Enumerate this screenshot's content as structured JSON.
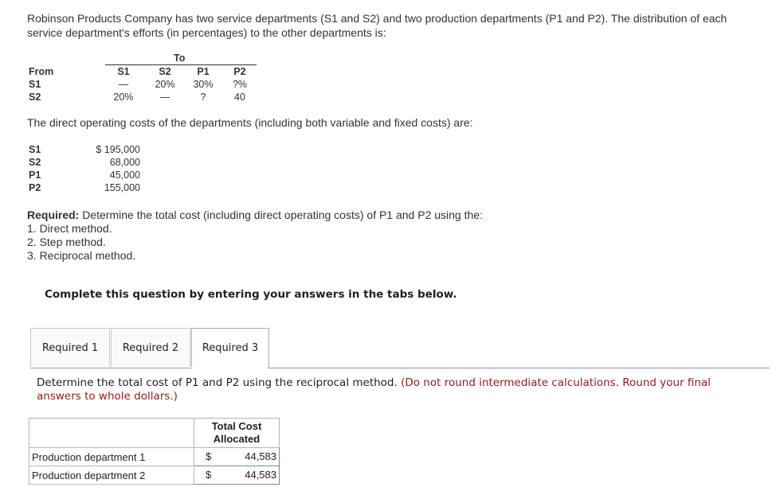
{
  "intro": "Robinson Products Company has two service departments (S1 and S2) and two production departments (P1 and P2). The distribution of each service department's efforts (in percentages) to the other departments is:",
  "distribution": {
    "to_label": "To",
    "from_label": "From",
    "columns": [
      "S1",
      "S2",
      "P1",
      "P2"
    ],
    "rows": [
      {
        "from": "S1",
        "values": [
          "—",
          "20%",
          "30%",
          "?%"
        ]
      },
      {
        "from": "S2",
        "values": [
          "20%",
          "—",
          "?",
          "40"
        ]
      }
    ]
  },
  "direct_costs_title": "The direct operating costs of the departments (including both variable and fixed costs) are:",
  "direct_costs": [
    {
      "dept": "S1",
      "value": "$ 195,000"
    },
    {
      "dept": "S2",
      "value": "68,000"
    },
    {
      "dept": "P1",
      "value": "45,000"
    },
    {
      "dept": "P2",
      "value": "155,000"
    }
  ],
  "required": {
    "label": "Required:",
    "text": " Determine the total cost (including direct operating costs) of P1 and P2 using the:",
    "items": [
      "1. Direct method.",
      "2. Step method.",
      "3. Reciprocal method."
    ]
  },
  "complete_text": "Complete this question by entering your answers in the tabs below.",
  "tabs": [
    {
      "label": "Required 1",
      "active": false
    },
    {
      "label": "Required 2",
      "active": false
    },
    {
      "label": "Required 3",
      "active": true
    }
  ],
  "instruction": {
    "main": "Determine the total cost of P1 and P2 using the reciprocal method. ",
    "note": "(Do not round intermediate calculations. Round your final answers to whole dollars.)"
  },
  "answer_table": {
    "header": "Total Cost Allocated",
    "header_line1": "Total Cost",
    "header_line2": "Allocated",
    "rows": [
      {
        "label": "Production department 1",
        "currency": "$",
        "value": "44,583"
      },
      {
        "label": "Production department 2",
        "currency": "$",
        "value": "44,583"
      }
    ]
  }
}
